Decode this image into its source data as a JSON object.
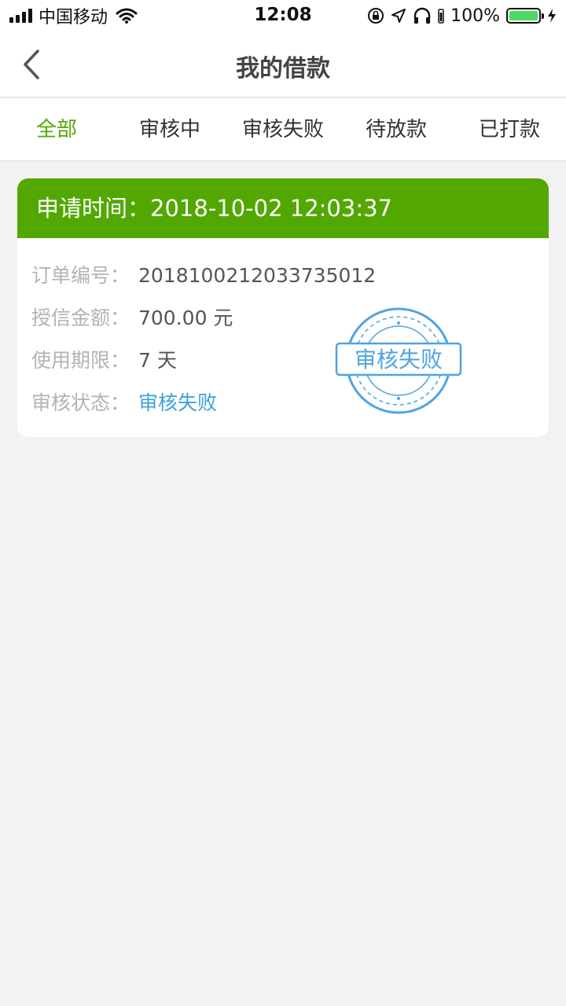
{
  "status_bar": {
    "carrier": "中国移动",
    "time": "12:08",
    "battery_percent": "100%",
    "battery_level": 1.0,
    "icons": [
      "signal-icon",
      "wifi-icon",
      "orientation-lock-icon",
      "location-icon",
      "headphones-icon",
      "battery-icon",
      "charging-icon"
    ]
  },
  "nav": {
    "title": "我的借款",
    "back_icon": "chevron-left-icon"
  },
  "tabs": [
    {
      "label": "全部",
      "active": true
    },
    {
      "label": "审核中",
      "active": false
    },
    {
      "label": "审核失败",
      "active": false
    },
    {
      "label": "待放款",
      "active": false
    },
    {
      "label": "已打款",
      "active": false
    }
  ],
  "card": {
    "header": "申请时间：2018-10-02 12:03:37",
    "rows": [
      {
        "label": "订单编号：",
        "value": "201810021203373501​2"
      },
      {
        "label": "授信金额：",
        "value": "700.00 元"
      },
      {
        "label": "使用期限：",
        "value": "7 天"
      },
      {
        "label": "审核状态：",
        "value": "审核失败"
      }
    ],
    "stamp_text": "审核失败"
  },
  "colors": {
    "accent_green": "#52a800",
    "status_blue": "#3f9fdf",
    "background": "#f2f2f2"
  }
}
